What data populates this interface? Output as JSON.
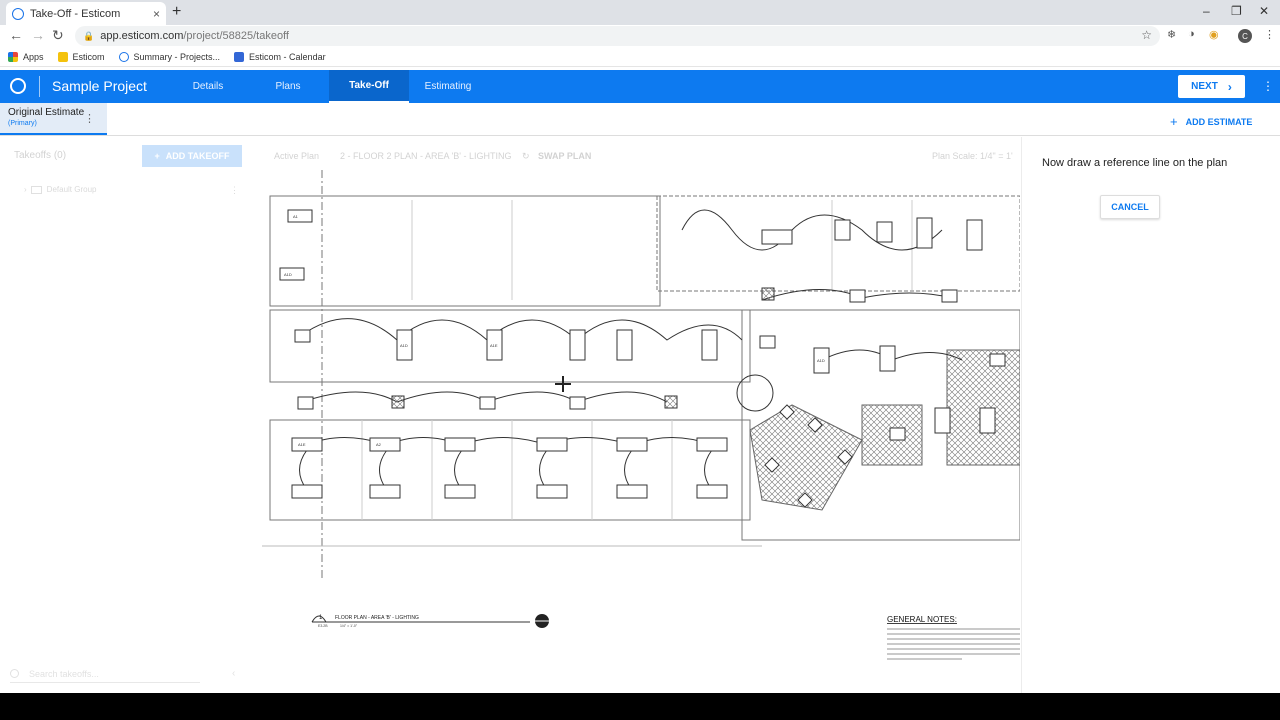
{
  "browser": {
    "tab_title": "Take-Off - Esticom",
    "tab_close": "×",
    "new_tab": "+",
    "url_host": "app.esticom.com",
    "url_path": "/project/58825/takeoff",
    "profile_initial": "C",
    "bookmarks": [
      {
        "label": "Apps",
        "color": "#e8453c"
      },
      {
        "label": "Esticom",
        "color": "#f4c20d"
      },
      {
        "label": "Summary - Projects...",
        "color": "#1a73e8"
      },
      {
        "label": "Esticom - Calendar",
        "color": "#3367d6"
      }
    ]
  },
  "app": {
    "project_name": "Sample Project",
    "tabs": [
      {
        "label": "Details",
        "active": false
      },
      {
        "label": "Plans",
        "active": false
      },
      {
        "label": "Take-Off",
        "active": true
      },
      {
        "label": "Estimating",
        "active": false
      }
    ],
    "next_label": "NEXT",
    "accent_color": "#0d7af0"
  },
  "estimate": {
    "name": "Original Estimate",
    "sub": "(Primary)",
    "add_label": "ADD ESTIMATE"
  },
  "left_panel": {
    "title": "Takeoffs (0)",
    "add_label": "ADD TAKEOFF",
    "group": "Default Group",
    "search_placeholder": "Search takeoffs..."
  },
  "plan_toolbar": {
    "active_plan": "Active Plan",
    "plan_name": "2 - FLOOR 2 PLAN - AREA 'B' - LIGHTING",
    "swap_label": "SWAP PLAN",
    "scale": "Plan Scale: 1/4\" = 1'"
  },
  "plan": {
    "title": "FLOOR PLAN - AREA 'B' - LIGHTING",
    "drawing_number": "1",
    "sheet_ref": "E3.2B",
    "scale_text": "1/4\" = 1'-0\"",
    "notes_title": "GENERAL NOTES:",
    "fixture_labels": [
      "A1",
      "A1D",
      "A1E",
      "A2",
      "A1D",
      "A1E",
      "A1D"
    ]
  },
  "right_panel": {
    "instruction": "Now draw a reference line on the plan",
    "cancel_label": "CANCEL"
  }
}
